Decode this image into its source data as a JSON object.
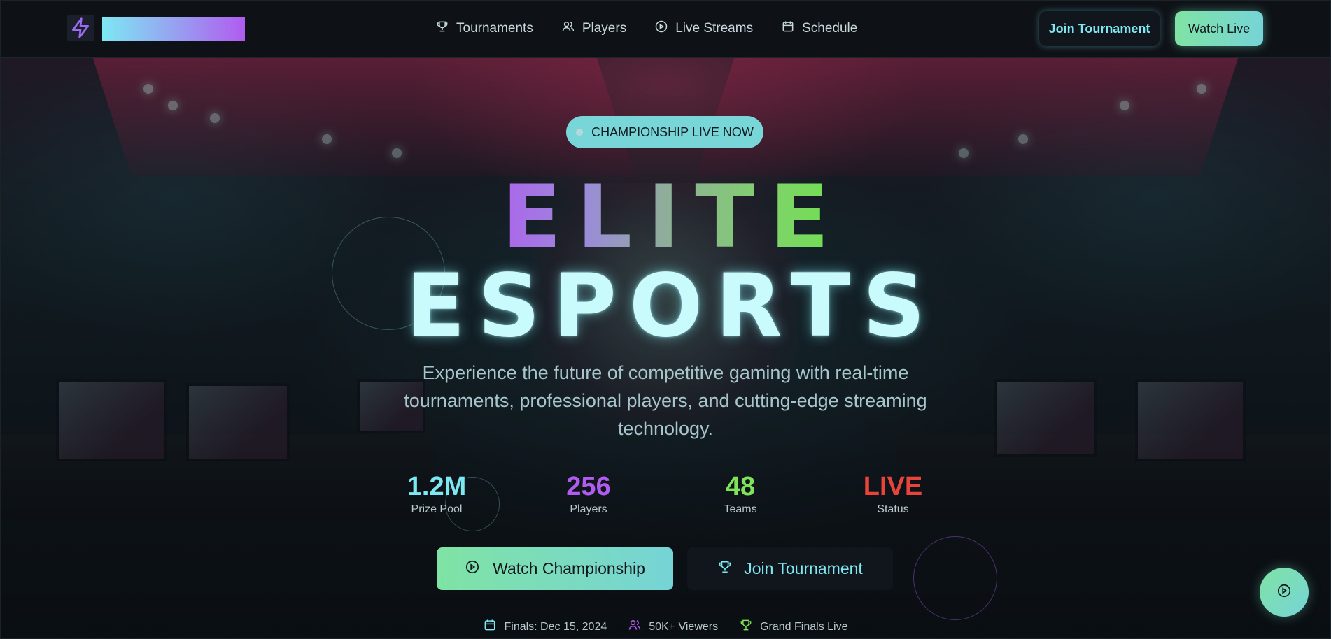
{
  "header": {
    "nav": [
      {
        "label": "Tournaments",
        "icon": "trophy-icon"
      },
      {
        "label": "Players",
        "icon": "users-icon"
      },
      {
        "label": "Live Streams",
        "icon": "play-circle-icon"
      },
      {
        "label": "Schedule",
        "icon": "calendar-icon"
      }
    ],
    "join_label": "Join Tournament",
    "watch_label": "Watch Live"
  },
  "hero": {
    "badge": "CHAMPIONSHIP LIVE NOW",
    "title_line1": "ELITE",
    "title_line2": "ESPORTS",
    "subtitle": "Experience the future of competitive gaming with real-time tournaments, professional players, and cutting-edge streaming technology.",
    "stats": [
      {
        "value": "1.2M",
        "label": "Prize Pool",
        "color": "#7de8f2"
      },
      {
        "value": "256",
        "label": "Players",
        "color": "#b05cf0"
      },
      {
        "value": "48",
        "label": "Teams",
        "color": "#7fe35a"
      },
      {
        "value": "LIVE",
        "label": "Status",
        "color": "#e8443c"
      }
    ],
    "watch_button": "Watch Championship",
    "join_button": "Join Tournament",
    "info": [
      {
        "text": "Finals: Dec 15, 2024",
        "icon": "calendar-icon",
        "color": "#7de8f2"
      },
      {
        "text": "50K+ Viewers",
        "icon": "users-icon",
        "color": "#b05cf0"
      },
      {
        "text": "Grand Finals Live",
        "icon": "trophy-icon",
        "color": "#7fe35a"
      }
    ]
  },
  "colors": {
    "accent_cyan": "#7de8f2",
    "accent_purple": "#b05cf0",
    "accent_green": "#7fe35a",
    "accent_red": "#e8443c"
  }
}
